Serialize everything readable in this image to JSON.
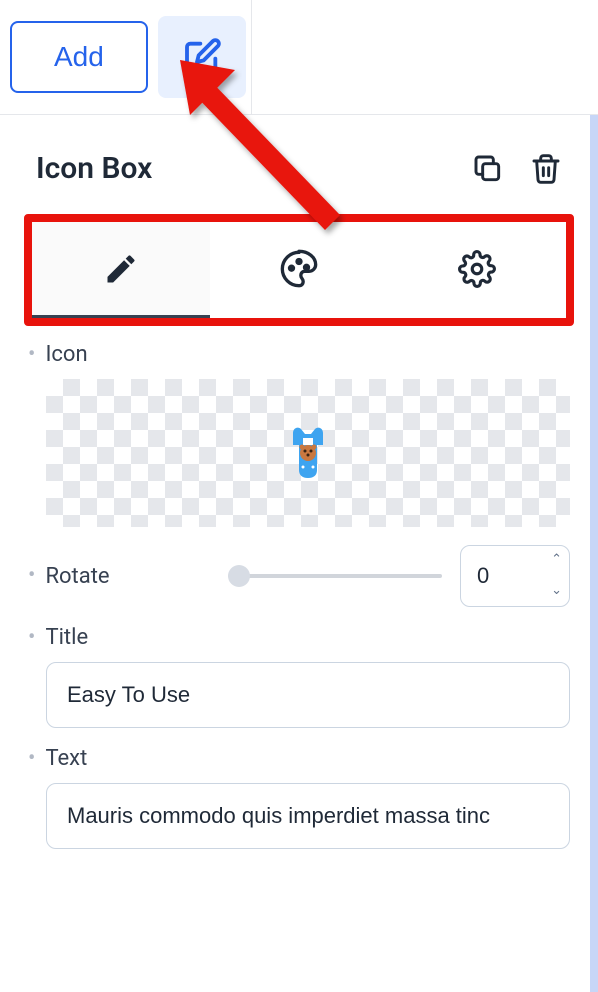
{
  "topbar": {
    "add_label": "Add"
  },
  "panel": {
    "title": "Icon Box"
  },
  "fields": {
    "icon": {
      "label": "Icon",
      "icon_emoji": "👕"
    },
    "rotate": {
      "label": "Rotate",
      "value": "0"
    },
    "title": {
      "label": "Title",
      "value": "Easy To Use"
    },
    "text": {
      "label": "Text",
      "value": "Mauris commodo quis imperdiet massa tinc"
    }
  }
}
